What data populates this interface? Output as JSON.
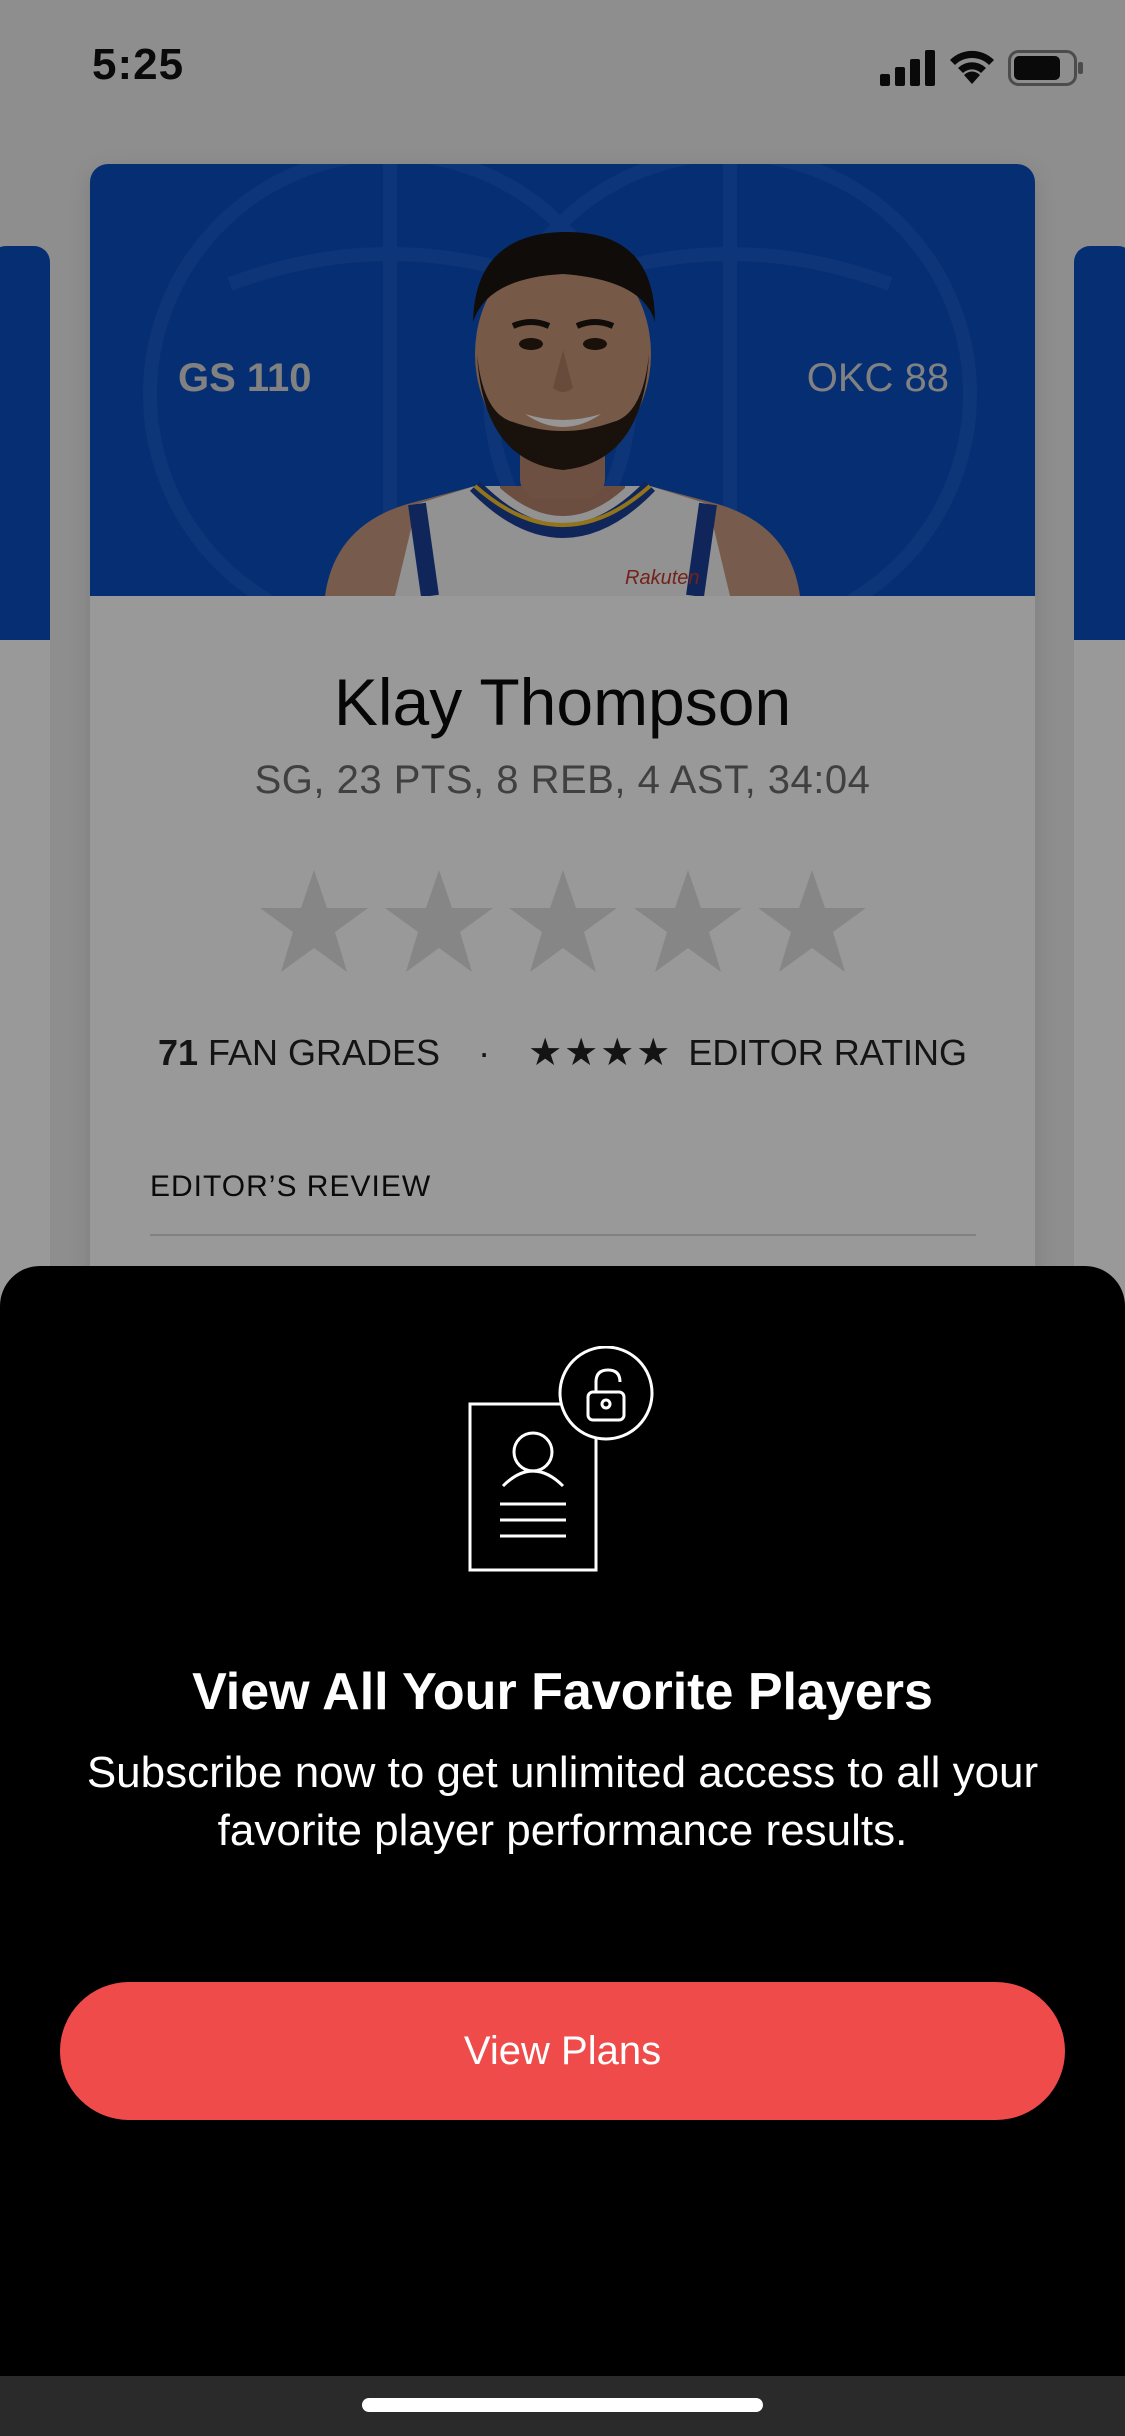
{
  "status_bar": {
    "time": "5:25"
  },
  "player_card": {
    "home_score": "GS 110",
    "away_score": "OKC 88",
    "player_name": "Klay Thompson",
    "stat_line": "SG, 23 PTS, 8 REB, 4 AST, 34:04",
    "rating_stars_filled": 0,
    "rating_stars_total": 5,
    "fan_grades_count": "71",
    "fan_grades_label": "FAN GRADES",
    "separator": "·",
    "editor_rating_stars": "★★★★",
    "editor_rating_label": "EDITOR RATING",
    "review_section_label": "EDITOR’S REVIEW",
    "jersey_sponsor": "Rakuten"
  },
  "paywall": {
    "title": "View All Your Favorite Players",
    "description": "Subscribe now to get unlimited access to all your favorite player performance results.",
    "button_label": "View Plans",
    "icon": "player-card-unlock-icon"
  },
  "colors": {
    "team_blue": "#0a4fc0",
    "accent_red": "#f04b4b",
    "sheet_bg": "#000000"
  }
}
